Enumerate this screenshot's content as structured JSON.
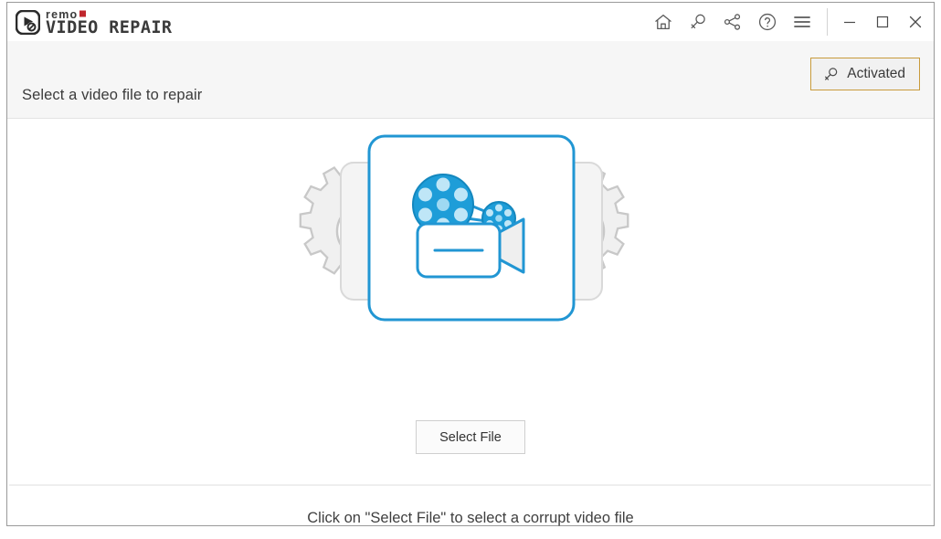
{
  "window": {
    "title_bar": {
      "brand": {
        "app_mark": "remo-logo-icon",
        "name_top": "remo",
        "name_main": "VIDEO REPAIR",
        "accent_color": "#c0272d"
      },
      "actions": [
        {
          "name": "home-icon",
          "tooltip": "Home"
        },
        {
          "name": "key-icon",
          "tooltip": "Activate"
        },
        {
          "name": "share-icon",
          "tooltip": "Share"
        },
        {
          "name": "help-icon",
          "tooltip": "Help"
        },
        {
          "name": "menu-icon",
          "tooltip": "Menu"
        }
      ],
      "window_controls": [
        {
          "name": "minimize-button",
          "glyph": "minimize"
        },
        {
          "name": "maximize-button",
          "glyph": "maximize"
        },
        {
          "name": "close-button",
          "glyph": "close"
        }
      ]
    },
    "sub_header": {
      "title": "Select a video file to repair",
      "activation": {
        "label": "Activated",
        "icon": "key-icon",
        "border_color": "#c89b3c"
      },
      "background_color": "#f6f6f6"
    },
    "main": {
      "illustration": {
        "name": "video-repair-illustration",
        "accent_color": "#2196d3",
        "gear_color": "#f0f0f0",
        "gear_stroke": "#c8c8c8"
      },
      "select_file_button": {
        "label": "Select File"
      },
      "footer_hint": "Click on \"Select File\" to select a corrupt video file"
    }
  }
}
